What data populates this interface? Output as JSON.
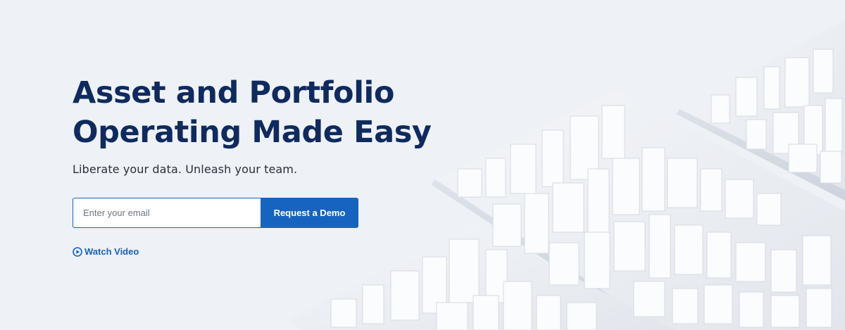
{
  "hero": {
    "headline_line1": "Asset and Portfolio",
    "headline_line2": "Operating Made Easy",
    "subheadline": "Liberate your data. Unleash your team.",
    "email_placeholder": "Enter your email",
    "cta_label": "Request a Demo",
    "video_link_label": "Watch Video",
    "video_icon": "play-circle-icon",
    "background_art": "white-3d-city-blocks"
  },
  "colors": {
    "page_background": "#eef1f6",
    "headline": "#0f2a5e",
    "body_text": "#2b2f38",
    "accent": "#1764c0",
    "button_text": "#ffffff"
  }
}
